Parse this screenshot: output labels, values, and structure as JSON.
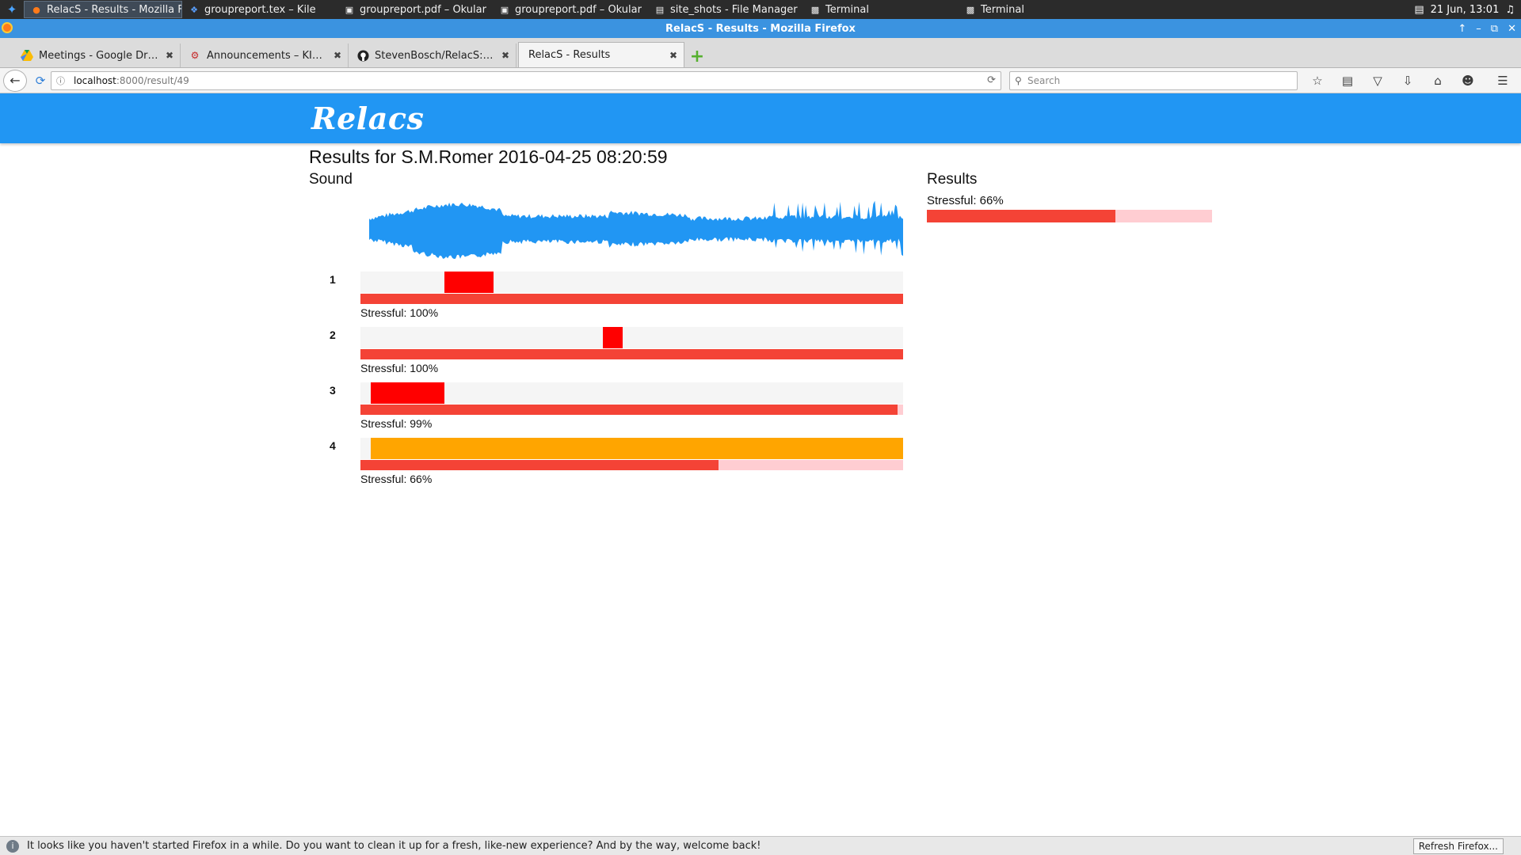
{
  "taskbar": {
    "tasks": [
      {
        "label": "RelacS - Results - Mozilla Fi...",
        "icon": "firefox-icon"
      },
      {
        "label": "groupreport.tex – Kile",
        "icon": "kile-icon"
      },
      {
        "label": "groupreport.pdf – Okular",
        "icon": "okular-icon"
      },
      {
        "label": "groupreport.pdf – Okular",
        "icon": "okular-icon"
      },
      {
        "label": "site_shots - File Manager",
        "icon": "folder-icon"
      },
      {
        "label": "Terminal",
        "icon": "terminal-icon"
      },
      {
        "label": "Terminal",
        "icon": "terminal-icon"
      }
    ],
    "clock": "21 Jun, 13:01"
  },
  "window": {
    "title": "RelacS - Results - Mozilla Firefox"
  },
  "tabs": [
    {
      "label": "Meetings - Google Drive",
      "icon": "google-drive-icon"
    },
    {
      "label": "Announcements – KIM....",
      "icon": "site-icon"
    },
    {
      "label": "StevenBosch/RelacS: So...",
      "icon": "github-icon"
    },
    {
      "label": "RelacS - Results",
      "icon": ""
    }
  ],
  "nav": {
    "url_host": "localhost",
    "url_path": ":8000/result/49",
    "search_placeholder": "Search"
  },
  "app": {
    "logo": "Relacs",
    "results_title": "Results for S.M.Romer 2016-04-25 08:20:59",
    "sound_heading": "Sound",
    "results_heading": "Results",
    "overall": {
      "label": "Stressful: 66%",
      "value": 0.66
    },
    "colors": {
      "header": "#2196f3",
      "waveform": "#2196f3",
      "stress_fill": "#f44336",
      "stress_track": "#ffcdd2",
      "segment_stressful": "#ff0000",
      "segment_moderate": "#ffa500"
    },
    "speakers": [
      {
        "num": "1",
        "label": "Stressful: 100%",
        "value": 1.0,
        "segments": [
          {
            "start": 0.155,
            "end": 0.245,
            "color": "#ff0000"
          }
        ]
      },
      {
        "num": "2",
        "label": "Stressful: 100%",
        "value": 1.0,
        "segments": [
          {
            "start": 0.447,
            "end": 0.483,
            "color": "#ff0000"
          }
        ]
      },
      {
        "num": "3",
        "label": "Stressful: 99%",
        "value": 0.99,
        "segments": [
          {
            "start": 0.019,
            "end": 0.155,
            "color": "#ff0000"
          }
        ]
      },
      {
        "num": "4",
        "label": "Stressful: 66%",
        "value": 0.66,
        "segments": [
          {
            "start": 0.019,
            "end": 1.0,
            "color": "#ffa500"
          }
        ]
      }
    ]
  },
  "notification": {
    "text": "It looks like you haven't started Firefox in a while. Do you want to clean it up for a fresh, like-new experience? And by the way, welcome back!",
    "button": "Refresh Firefox..."
  }
}
